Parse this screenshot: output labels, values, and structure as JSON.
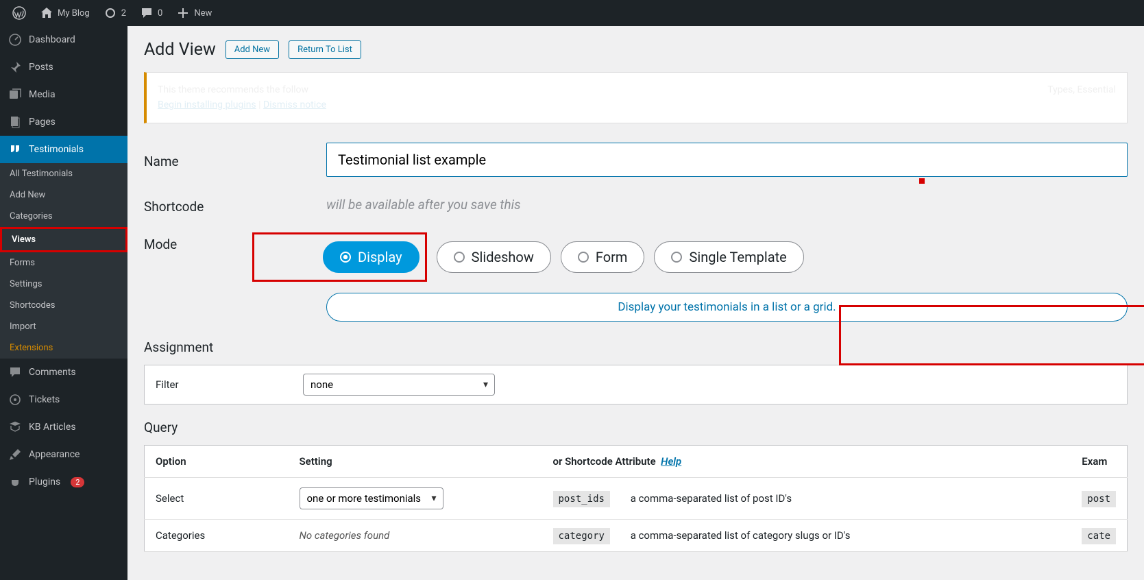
{
  "adminBar": {
    "siteName": "My Blog",
    "updates": "2",
    "comments": "0",
    "new": "New"
  },
  "sidebar": {
    "dashboard": "Dashboard",
    "posts": "Posts",
    "media": "Media",
    "pages": "Pages",
    "testimonials": "Testimonials",
    "sub": {
      "all": "All Testimonials",
      "addNew": "Add New",
      "categories": "Categories",
      "views": "Views",
      "forms": "Forms",
      "settings": "Settings",
      "shortcodes": "Shortcodes",
      "import": "Import",
      "extensions": "Extensions"
    },
    "commentsItem": "Comments",
    "tickets": "Tickets",
    "kb": "KB Articles",
    "appearance": "Appearance",
    "plugins": "Plugins",
    "pluginsBadge": "2"
  },
  "page": {
    "title": "Add View",
    "addNewBtn": "Add New",
    "returnBtn": "Return To List"
  },
  "notice": {
    "line1a": "This theme recommends the follow",
    "line1b": "Types, Essential",
    "line2a": "Begin installing plugins",
    "line2sep": " | ",
    "line2b": "Dismiss notice"
  },
  "form": {
    "nameLabel": "Name",
    "nameValue": "Testimonial list example",
    "shortcodeLabel": "Shortcode",
    "shortcodeHint": "will be available after you save this",
    "modeLabel": "Mode",
    "modes": {
      "display": "Display",
      "slideshow": "Slideshow",
      "form": "Form",
      "single": "Single Template"
    },
    "modeDesc": "Display your testimonials in a list or a grid."
  },
  "assignment": {
    "title": "Assignment",
    "filterLabel": "Filter",
    "filterValue": "none"
  },
  "query": {
    "title": "Query",
    "headers": {
      "option": "Option",
      "setting": "Setting",
      "attr": "or Shortcode Attribute",
      "help": "Help",
      "exam": "Exam"
    },
    "rows": [
      {
        "option": "Select",
        "setting": "one or more testimonials",
        "code": "post_ids",
        "desc": "a comma-separated list of post ID's",
        "exam": "post"
      },
      {
        "option": "Categories",
        "setting": "No categories found",
        "code": "category",
        "desc": "a comma-separated list of category slugs or ID's",
        "exam": "cate"
      }
    ]
  }
}
